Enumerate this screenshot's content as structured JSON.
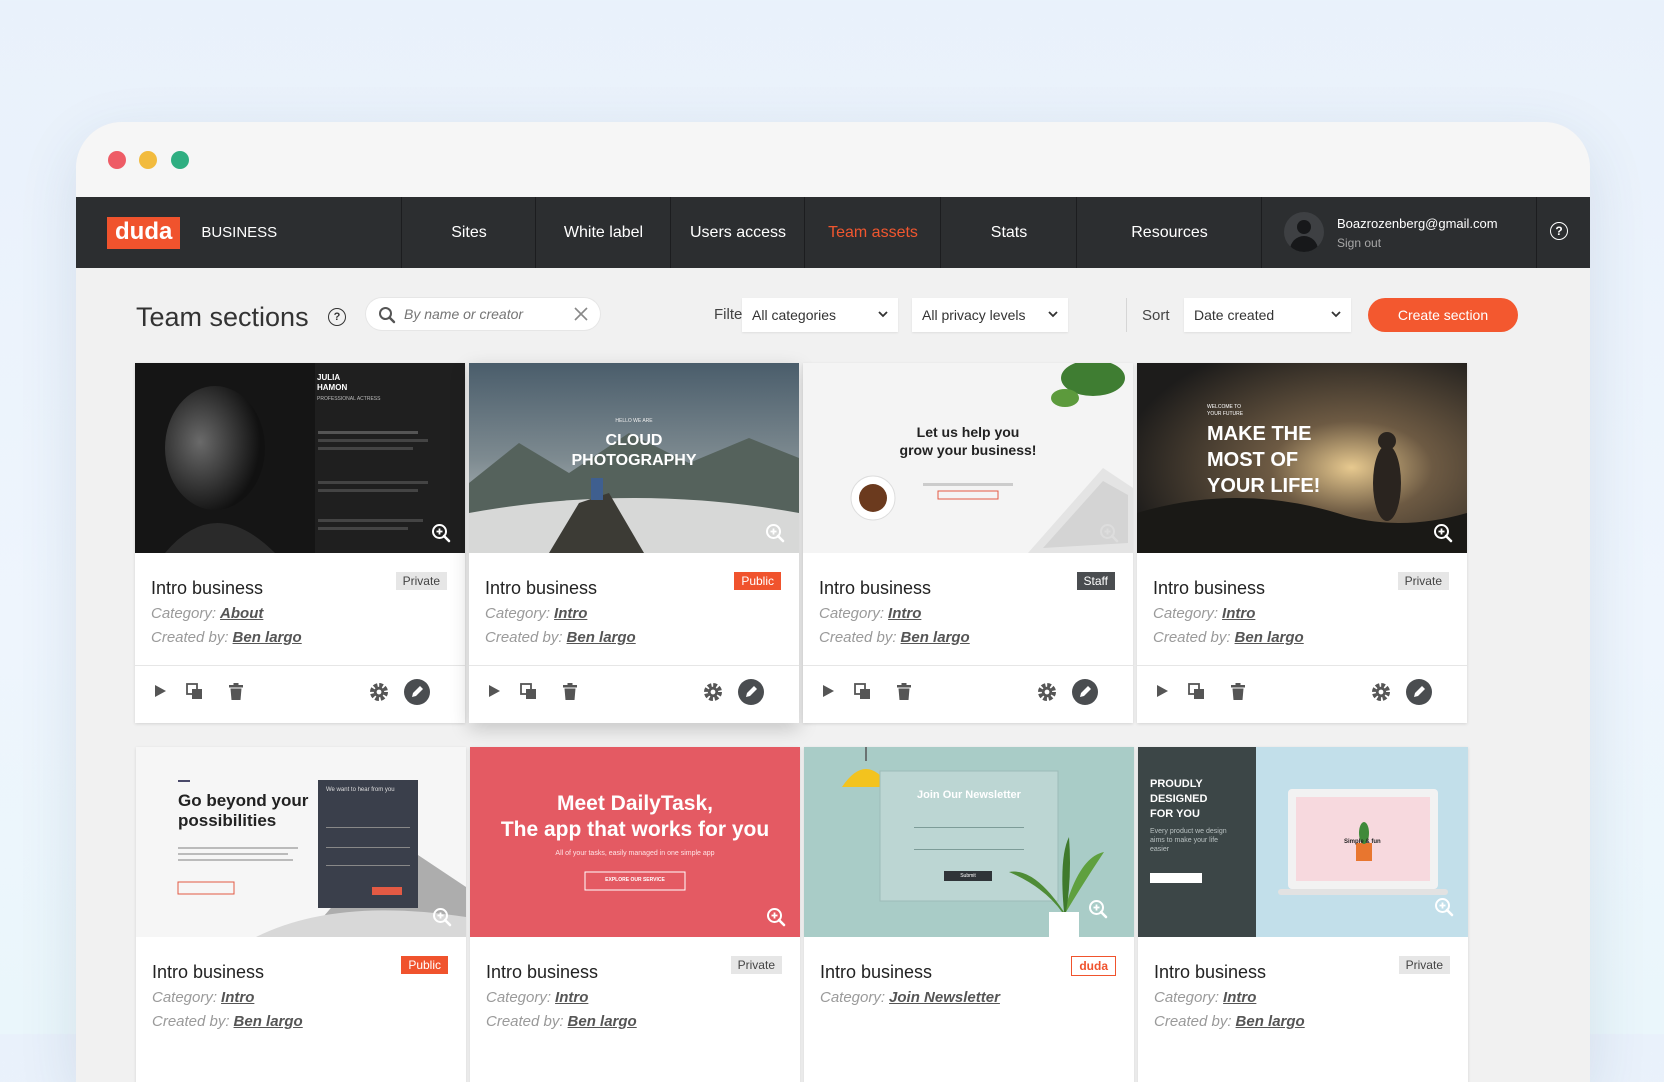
{
  "nav": {
    "logo": "duda",
    "brand": "BUSINESS",
    "items": [
      "Sites",
      "White label",
      "Users access",
      "Team assets",
      "Stats",
      "Resources"
    ],
    "active": "Team assets",
    "user_email": "Boazrozenberg@gmail.com",
    "sign_out": "Sign out",
    "help": "?"
  },
  "toolbar": {
    "title": "Team sections",
    "help": "?",
    "search_placeholder": "By name or creator",
    "filter_label": "Filter",
    "category_select": "All categories",
    "privacy_select": "All privacy levels",
    "sort_label": "Sort",
    "sort_select": "Date created",
    "create_button": "Create section"
  },
  "labels": {
    "category": "Category:",
    "created_by": "Created by:"
  },
  "thumb_text": {
    "t0_name": "JULIA\nHAMON",
    "t0_role": "PROFESSIONAL ACTRESS",
    "t1_kicker": "HELLO WE ARE",
    "t1_title": "CLOUD\nPHOTOGRAPHY",
    "t2_title": "Let us help you\ngrow your business!",
    "t3_kicker": "WELCOME TO\nYOUR FUTURE",
    "t3_title": "MAKE THE\nMOST OF\nYOUR LIFE!",
    "t4_title": "Go beyond your\npossibilities",
    "t4_form": "We want to hear from you",
    "t5_title": "Meet DailyTask,\nThe app that works for you",
    "t5_sub": "All of your tasks, easily managed in one simple app",
    "t5_btn": "EXPLORE OUR SERVICE",
    "t6_title": "Join Our Newsletter",
    "t6_btn": "Submit",
    "t7_title": "PROUDLY\nDESIGNED\nFOR YOU",
    "t7_sub": "Every product we design\naims to make your life\neasier",
    "t7_product": "Simple & fun"
  },
  "cards": [
    {
      "title": "Intro business",
      "badge": "Private",
      "badge_type": "private",
      "category": "About",
      "creator": "Ben largo"
    },
    {
      "title": "Intro business",
      "badge": "Public",
      "badge_type": "public",
      "category": "Intro",
      "creator": "Ben largo"
    },
    {
      "title": "Intro business",
      "badge": "Staff",
      "badge_type": "staff",
      "category": "Intro",
      "creator": "Ben largo"
    },
    {
      "title": "Intro business",
      "badge": "Private",
      "badge_type": "private",
      "category": "Intro",
      "creator": "Ben largo"
    },
    {
      "title": "Intro business",
      "badge": "Public",
      "badge_type": "public",
      "category": "Intro",
      "creator": "Ben largo"
    },
    {
      "title": "Intro business",
      "badge": "Private",
      "badge_type": "private",
      "category": "Intro",
      "creator": "Ben largo"
    },
    {
      "title": "Intro business",
      "badge": "duda",
      "badge_type": "duda",
      "category": "Join Newsletter",
      "creator": ""
    },
    {
      "title": "Intro business",
      "badge": "Private",
      "badge_type": "private",
      "category": "Intro",
      "creator": "Ben largo"
    }
  ],
  "colors": {
    "accent": "#f0532d",
    "nav_bg": "#2c2e30"
  }
}
